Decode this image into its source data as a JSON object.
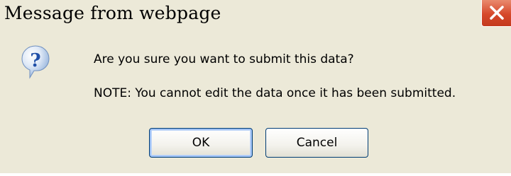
{
  "dialog": {
    "title": "Message from webpage",
    "close_icon": "close-x-icon",
    "icon": "question-icon",
    "message": "Are you sure you want to submit this data?",
    "note": "NOTE: You cannot edit the data once it has been submitted.",
    "buttons": {
      "ok_label": "OK",
      "cancel_label": "Cancel"
    }
  },
  "colors": {
    "dialog_background": "#ece9d8",
    "close_button": "#d6482a",
    "button_border": "#003c74",
    "question_icon": "#2a64c8"
  }
}
